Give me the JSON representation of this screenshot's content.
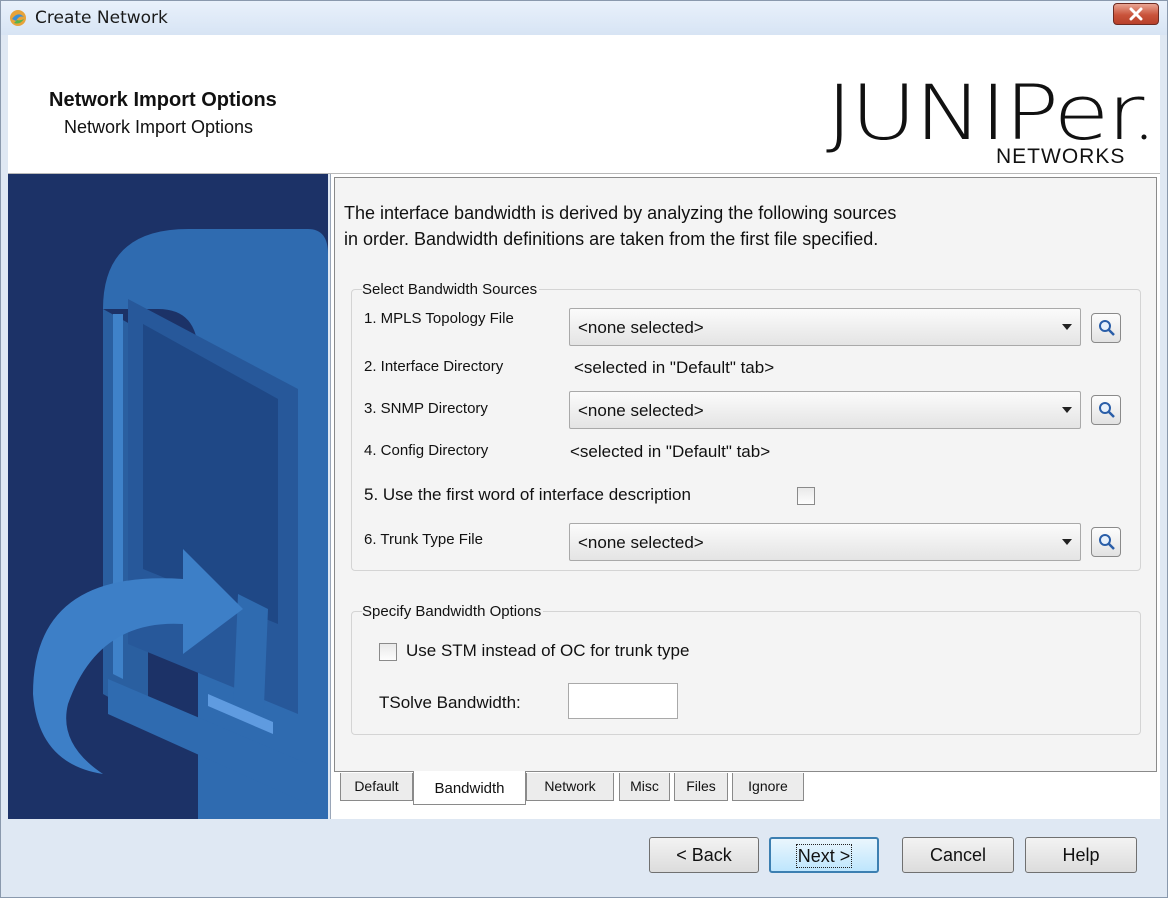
{
  "window": {
    "title": "Create Network"
  },
  "header": {
    "title": "Network Import Options",
    "subtitle": "Network Import Options",
    "logo_word": "JUNIPer",
    "logo_sub": "NETWORKS"
  },
  "intro": {
    "line1": "The interface bandwidth is derived by analyzing the following sources",
    "line2": "in order.  Bandwidth definitions are taken from the first file specified."
  },
  "sources": {
    "legend": "Select Bandwidth Sources",
    "mpls_label": "1. MPLS Topology File",
    "mpls_value": "<none selected>",
    "iface_label": "2. Interface Directory",
    "iface_value": "<selected in \"Default\" tab>",
    "snmp_label": "3. SNMP Directory",
    "snmp_value": "<none selected>",
    "config_label": "4. Config Directory",
    "config_value": "<selected in \"Default\" tab>",
    "firstword_label": "5. Use the first word of interface description",
    "firstword_checked": false,
    "trunk_label": "6. Trunk Type File",
    "trunk_value": "<none selected>"
  },
  "options": {
    "legend": "Specify Bandwidth Options",
    "stm_label": "Use STM instead of OC for trunk type",
    "stm_checked": false,
    "tsolve_label": "TSolve Bandwidth:",
    "tsolve_value": ""
  },
  "tabs": [
    {
      "label": "Default",
      "active": false
    },
    {
      "label": "Bandwidth",
      "active": true
    },
    {
      "label": "Network",
      "active": false
    },
    {
      "label": "Misc",
      "active": false
    },
    {
      "label": "Files",
      "active": false
    },
    {
      "label": "Ignore",
      "active": false
    }
  ],
  "buttons": {
    "back": "< Back",
    "next": "Next >",
    "cancel": "Cancel",
    "help": "Help"
  },
  "colors": {
    "banner": "#1c3267",
    "banner_art": "#2f6bb0",
    "default_button_border": "#3c7fb1",
    "close_button": "#c9533b"
  },
  "icons": {
    "app": "app-icon",
    "close": "close-icon",
    "browse": "magnifier-icon",
    "combo_arrow": "chevron-down-icon"
  }
}
